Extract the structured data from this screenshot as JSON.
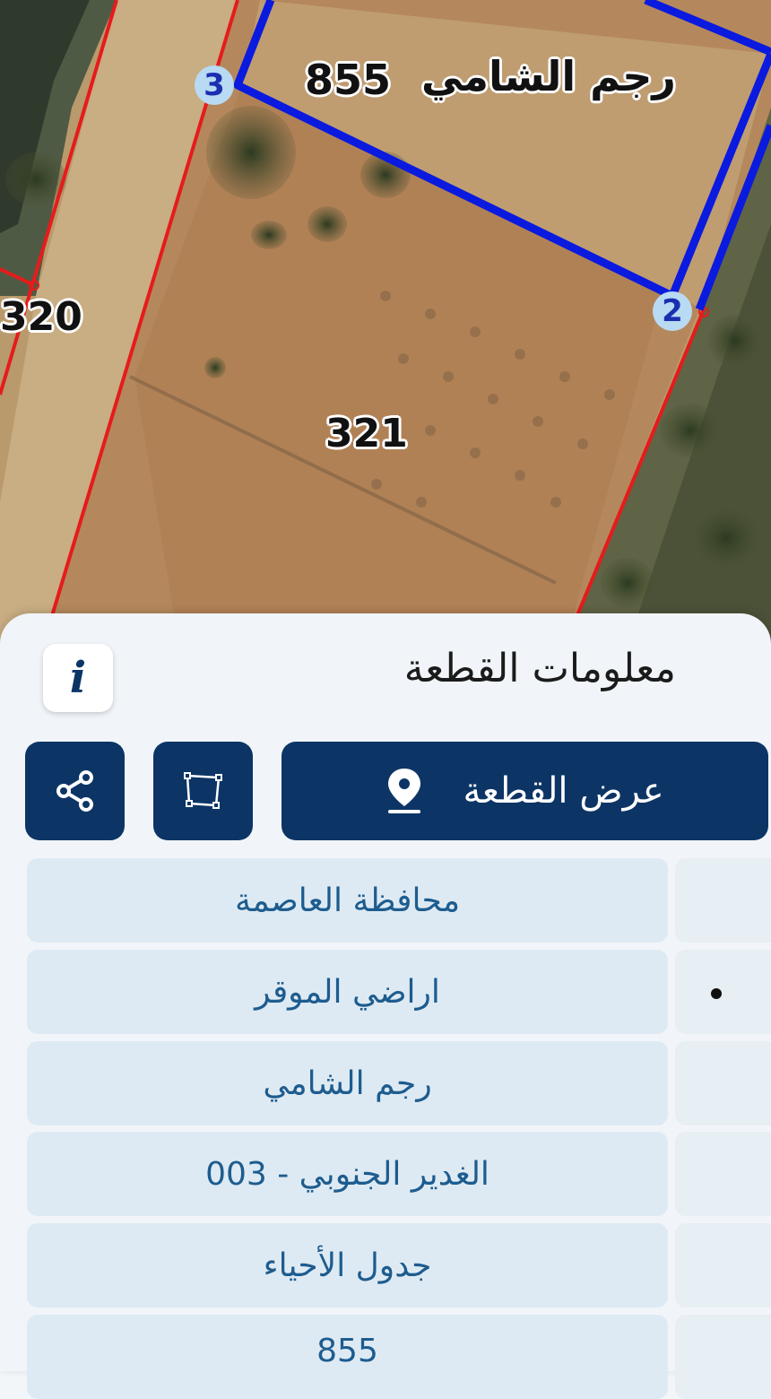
{
  "map": {
    "parcel_labels": {
      "left": "320",
      "center": "321"
    },
    "selected_parcel": {
      "name": "رجم الشامي",
      "number": "855"
    },
    "vertices": [
      "3",
      "2"
    ],
    "colors": {
      "selected_outline": "#0a1adf",
      "parcel_outline": "#e61b1b",
      "vertex_badge": "#b8daf2"
    }
  },
  "panel": {
    "title": "معلومات القطعة",
    "info_icon": "i",
    "view_parcel_label": "عرض القطعة",
    "icons": {
      "share": "share-icon",
      "shape": "polygon-icon",
      "location": "location-pin-icon"
    },
    "accent_color": "#0c3566"
  },
  "details": [
    {
      "value": "محافظة العاصمة"
    },
    {
      "value": "اراضي الموقر"
    },
    {
      "value": "رجم الشامي"
    },
    {
      "value": "الغدير الجنوبي - 003"
    },
    {
      "value": "جدول الأحياء"
    },
    {
      "value": "855"
    }
  ]
}
